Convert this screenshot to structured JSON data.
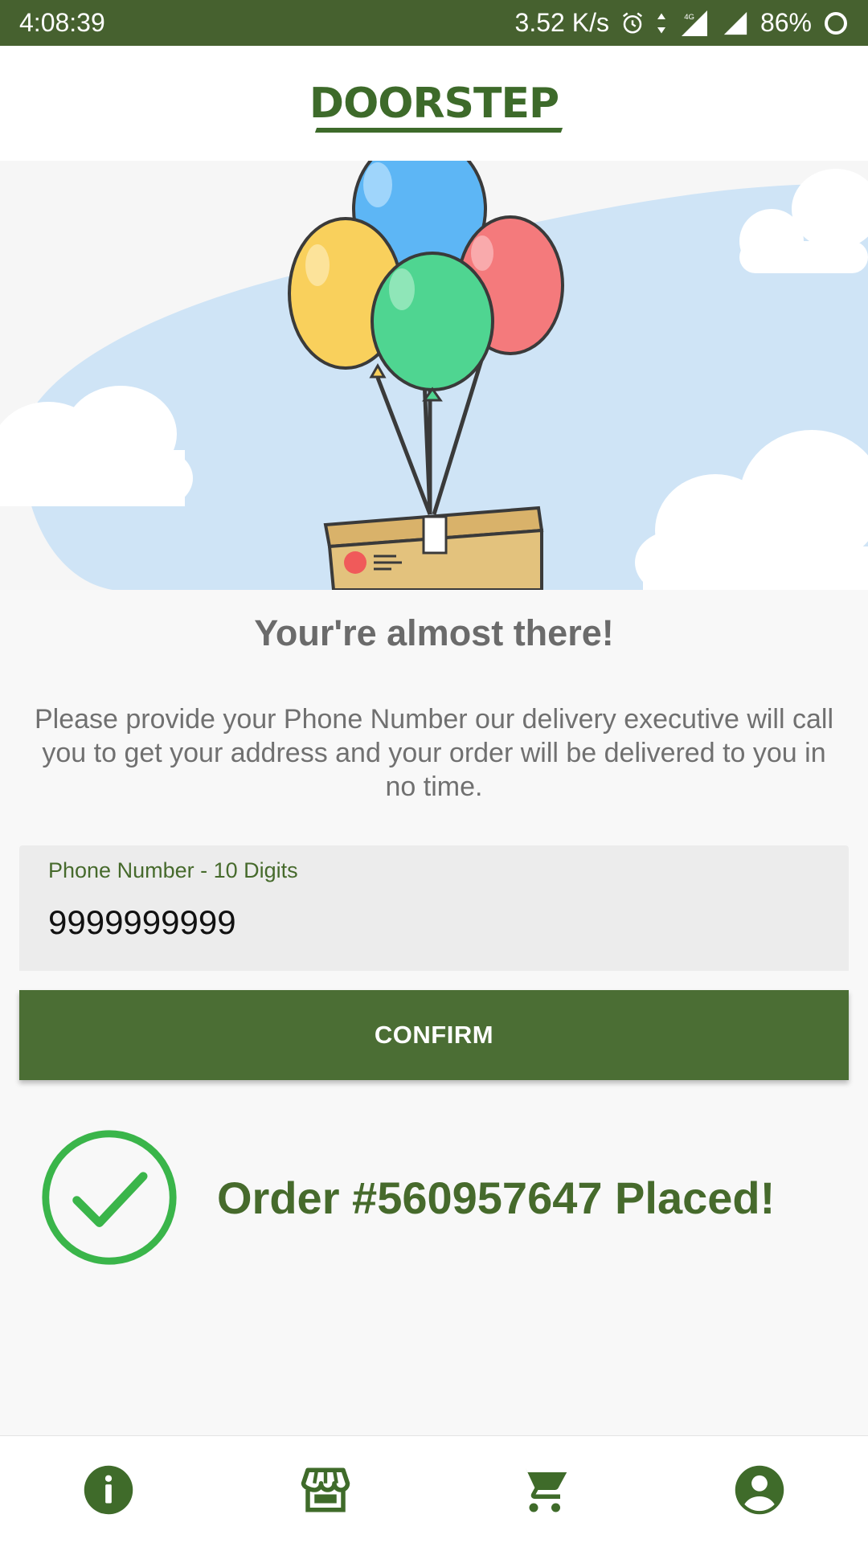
{
  "status_bar": {
    "time": "4:08:39",
    "speed": "3.52 K/s",
    "network": "4G",
    "battery": "86%",
    "icons": [
      "alarm-icon",
      "data-arrows-icon",
      "signal-icon",
      "signal-icon",
      "battery-ring-icon"
    ]
  },
  "app_bar": {
    "logo_text": "DOORSTEP"
  },
  "hero": {
    "illustration": "balloons-carrying-package",
    "colors": {
      "sky": "#cfe4f6",
      "balloon_blue": "#5db6f5",
      "balloon_yellow": "#f9d05c",
      "balloon_red": "#f47a7c",
      "balloon_green": "#4fd591",
      "box": "#e3c27d"
    }
  },
  "content": {
    "heading": "Your're almost there!",
    "description": "Please provide your Phone Number our delivery executive will call you to get your address and your order will be delivered to you in no time.",
    "phone_field": {
      "label": "Phone Number - 10 Digits",
      "value": "9999999999"
    },
    "confirm_label": "CONFIRM",
    "order_status": "Order #560957647 Placed!"
  },
  "bottom_nav": {
    "items": [
      {
        "icon": "info-icon"
      },
      {
        "icon": "store-icon"
      },
      {
        "icon": "cart-icon"
      },
      {
        "icon": "account-icon"
      }
    ]
  },
  "colors": {
    "primary": "#4b6e34",
    "status_bar": "#46612f",
    "success": "#3ab54a"
  }
}
